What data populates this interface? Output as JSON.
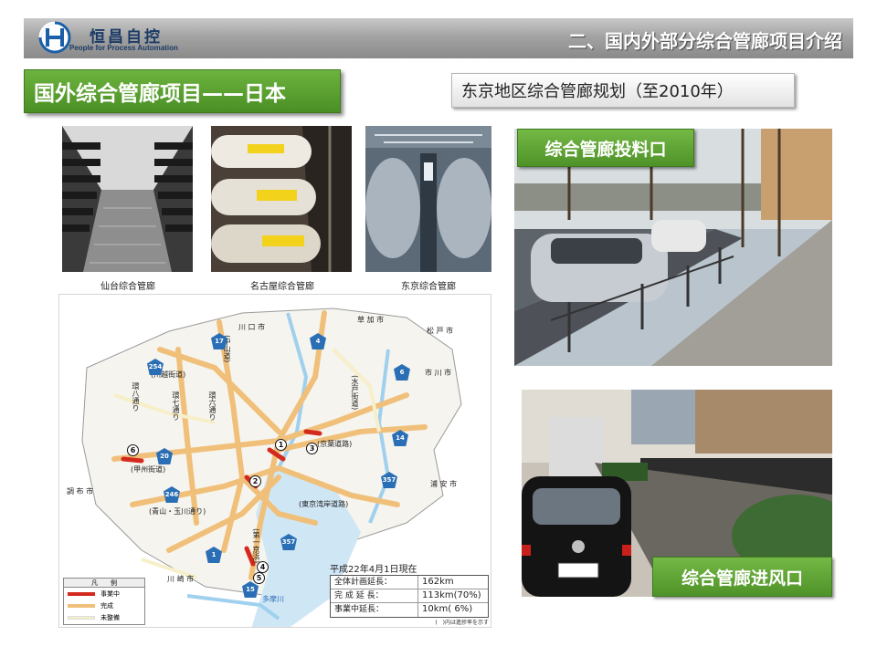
{
  "header": {
    "logo_cn": "恒昌自控",
    "logo_en": "People for Process Automation",
    "title": "二、国内外部分综合管廊项目介绍"
  },
  "section_title": "国外综合管廊项目——日本",
  "sub_title": "东京地区综合管廊规划（至2010年）",
  "photos": {
    "sendai": {
      "caption": "仙台综合管廊"
    },
    "nagoya": {
      "caption": "名古屋综合管廊"
    },
    "tokyo": {
      "caption": "东京综合管廊"
    },
    "feed_port": {
      "tag": "综合管廊投料口"
    },
    "vent": {
      "tag": "综合管廊进风口"
    }
  },
  "map": {
    "places": {
      "kawaguchi": "川 口 市",
      "soka": "草 加 市",
      "matsudo": "松 戸 市",
      "ichikawa": "市 川 市",
      "urayasu": "浦 安 市",
      "chofu": "調 布 市",
      "kawasaki": "川 崎 市",
      "kanpachi": "環八通り",
      "kannana": "環七通り",
      "kanroku": "環六通り"
    },
    "roads": {
      "kawagoe": "(川越街道)",
      "koshu": "(甲州街道)",
      "aoyama": "(青山・玉川通り)",
      "keiyo": "(京葉道路)",
      "mito": "(水戸街道)",
      "tokyo_bay": "(東京湾岸道路)",
      "nakasendo": "(中山道)",
      "daisan": "(第一京浜)"
    },
    "route_badges": [
      "17",
      "4",
      "254",
      "6",
      "20",
      "14",
      "246",
      "357",
      "357",
      "1",
      "15"
    ],
    "circled_numbers": [
      "1",
      "2",
      "3",
      "4",
      "5",
      "6"
    ],
    "legend": {
      "title": "凡　　例",
      "items": [
        {
          "label": "事業中",
          "color": "#d42a1e"
        },
        {
          "label": "完成",
          "color": "#f0c07a"
        },
        {
          "label": "未整備",
          "color": "#f7efc9"
        }
      ]
    },
    "stats": {
      "date": "平成22年4月1日現在",
      "rows": [
        {
          "key": "全体計画延長：",
          "value": "162km"
        },
        {
          "key": "完 成 延 長：",
          "value": "113km(70%)"
        },
        {
          "key": "事業中延長：",
          "value": "10km(  6%)"
        }
      ],
      "note": "(　)内は進捗率を示す"
    },
    "bottom_label": "多摩川"
  }
}
